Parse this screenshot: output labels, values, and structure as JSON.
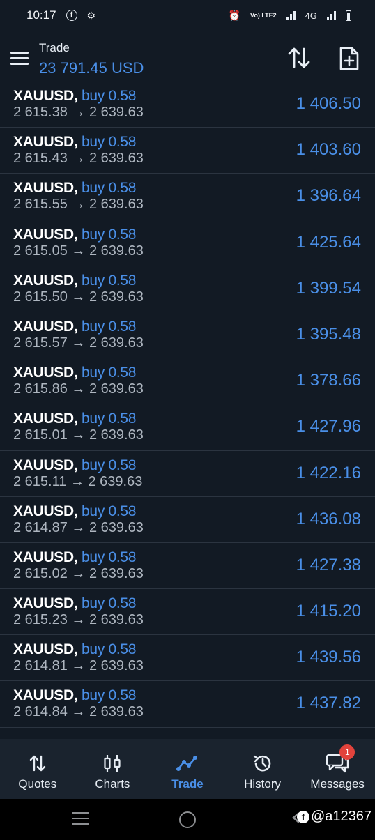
{
  "status_bar": {
    "time": "10:17",
    "network": "4G",
    "volte": "Vo) LTE2"
  },
  "header": {
    "title": "Trade",
    "balance": "23 791.45 USD"
  },
  "trades": [
    {
      "symbol": "XAUUSD,",
      "side": "buy 0.58",
      "open": "2 615.38",
      "arrow": "→",
      "current": "2 639.63",
      "profit": "1 406.50"
    },
    {
      "symbol": "XAUUSD,",
      "side": "buy 0.58",
      "open": "2 615.43",
      "arrow": "→",
      "current": "2 639.63",
      "profit": "1 403.60"
    },
    {
      "symbol": "XAUUSD,",
      "side": "buy 0.58",
      "open": "2 615.55",
      "arrow": "→",
      "current": "2 639.63",
      "profit": "1 396.64"
    },
    {
      "symbol": "XAUUSD,",
      "side": "buy 0.58",
      "open": "2 615.05",
      "arrow": "→",
      "current": "2 639.63",
      "profit": "1 425.64"
    },
    {
      "symbol": "XAUUSD,",
      "side": "buy 0.58",
      "open": "2 615.50",
      "arrow": "→",
      "current": "2 639.63",
      "profit": "1 399.54"
    },
    {
      "symbol": "XAUUSD,",
      "side": "buy 0.58",
      "open": "2 615.57",
      "arrow": "→",
      "current": "2 639.63",
      "profit": "1 395.48"
    },
    {
      "symbol": "XAUUSD,",
      "side": "buy 0.58",
      "open": "2 615.86",
      "arrow": "→",
      "current": "2 639.63",
      "profit": "1 378.66"
    },
    {
      "symbol": "XAUUSD,",
      "side": "buy 0.58",
      "open": "2 615.01",
      "arrow": "→",
      "current": "2 639.63",
      "profit": "1 427.96"
    },
    {
      "symbol": "XAUUSD,",
      "side": "buy 0.58",
      "open": "2 615.11",
      "arrow": "→",
      "current": "2 639.63",
      "profit": "1 422.16"
    },
    {
      "symbol": "XAUUSD,",
      "side": "buy 0.58",
      "open": "2 614.87",
      "arrow": "→",
      "current": "2 639.63",
      "profit": "1 436.08"
    },
    {
      "symbol": "XAUUSD,",
      "side": "buy 0.58",
      "open": "2 615.02",
      "arrow": "→",
      "current": "2 639.63",
      "profit": "1 427.38"
    },
    {
      "symbol": "XAUUSD,",
      "side": "buy 0.58",
      "open": "2 615.23",
      "arrow": "→",
      "current": "2 639.63",
      "profit": "1 415.20"
    },
    {
      "symbol": "XAUUSD,",
      "side": "buy 0.58",
      "open": "2 614.81",
      "arrow": "→",
      "current": "2 639.63",
      "profit": "1 439.56"
    },
    {
      "symbol": "XAUUSD,",
      "side": "buy 0.58",
      "open": "2 614.84",
      "arrow": "→",
      "current": "2 639.63",
      "profit": "1 437.82"
    }
  ],
  "nav": {
    "quotes": "Quotes",
    "charts": "Charts",
    "trade": "Trade",
    "history": "History",
    "messages": "Messages",
    "messages_badge": "1",
    "active": "trade"
  },
  "watermark": {
    "icon": "f",
    "handle": "@a12367"
  },
  "colors": {
    "background": "#121a24",
    "accent": "#4a8fe7",
    "nav_background": "#1a232e",
    "badge": "#e2433c"
  },
  "icons": [
    "menu-icon",
    "sort-icon",
    "new-document-icon",
    "quotes-icon",
    "charts-icon",
    "trade-icon",
    "history-icon",
    "messages-icon"
  ]
}
